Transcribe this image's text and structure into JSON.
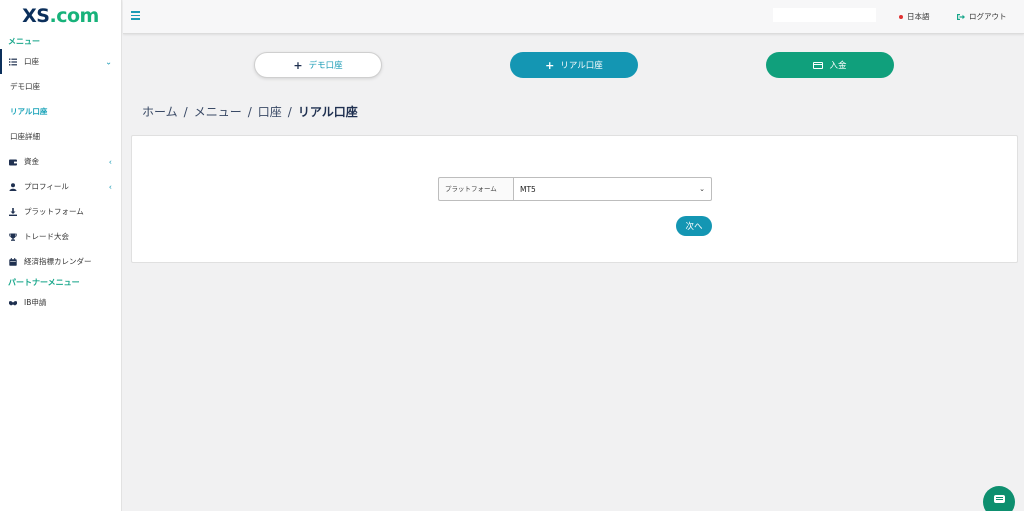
{
  "brand": {
    "logo_main": "XS",
    "logo_suffix": ".com",
    "logo_color": "#0b2f5b",
    "accent_color": "#17b27a"
  },
  "sidebar": {
    "menu_heading": "メニュー",
    "items": [
      {
        "label": "口座",
        "icon": "list-icon",
        "expanded": true,
        "children": [
          {
            "label": "デモ口座"
          },
          {
            "label": "リアル口座",
            "current": true
          },
          {
            "label": "口座詳細"
          }
        ]
      },
      {
        "label": "資金",
        "icon": "wallet-icon"
      },
      {
        "label": "プロフィール",
        "icon": "user-icon"
      },
      {
        "label": "プラットフォーム",
        "icon": "download-icon"
      },
      {
        "label": "トレード大会",
        "icon": "trophy-icon"
      },
      {
        "label": "経済指標カレンダー",
        "icon": "calendar-icon"
      }
    ],
    "partner_heading": "パートナーメニュー",
    "partner_items": [
      {
        "label": "IB申請",
        "icon": "handshake-icon"
      }
    ]
  },
  "topbar": {
    "search_value": "",
    "language": "日本語",
    "logout": "ログアウト"
  },
  "actions": {
    "demo": "デモ口座",
    "real": "リアル口座",
    "deposit": "入金",
    "real_color": "#1496b3",
    "deposit_color": "#10a07c"
  },
  "breadcrumb": [
    "ホーム",
    "メニュー",
    "口座",
    "リアル口座"
  ],
  "form": {
    "platform_label": "プラットフォーム",
    "platform_value": "MT5",
    "next_button": "次へ"
  }
}
